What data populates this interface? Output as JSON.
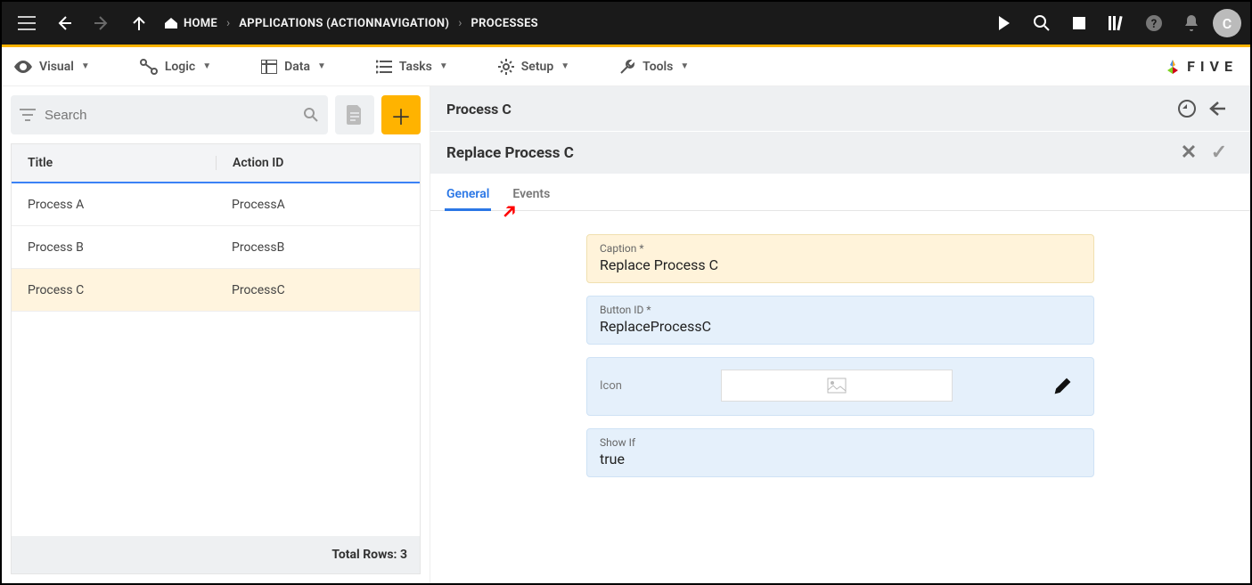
{
  "topbar": {
    "breadcrumb": {
      "home": "HOME",
      "apps": "APPLICATIONS (ACTIONNAVIGATION)",
      "processes": "PROCESSES"
    },
    "avatar_initial": "C"
  },
  "menubar": {
    "visual": "Visual",
    "logic": "Logic",
    "data": "Data",
    "tasks": "Tasks",
    "setup": "Setup",
    "tools": "Tools",
    "brand": "FIVE"
  },
  "left": {
    "search_placeholder": "Search",
    "columns": {
      "title": "Title",
      "action_id": "Action ID"
    },
    "rows": [
      {
        "title": "Process A",
        "action_id": "ProcessA"
      },
      {
        "title": "Process B",
        "action_id": "ProcessB"
      },
      {
        "title": "Process C",
        "action_id": "ProcessC"
      }
    ],
    "footer": "Total Rows: 3"
  },
  "right": {
    "header": "Process C",
    "subheader": "Replace Process C",
    "tabs": {
      "general": "General",
      "events": "Events"
    },
    "form": {
      "caption_label": "Caption *",
      "caption_value": "Replace Process C",
      "button_id_label": "Button ID *",
      "button_id_value": "ReplaceProcessC",
      "icon_label": "Icon",
      "showif_label": "Show If",
      "showif_value": "true"
    }
  }
}
